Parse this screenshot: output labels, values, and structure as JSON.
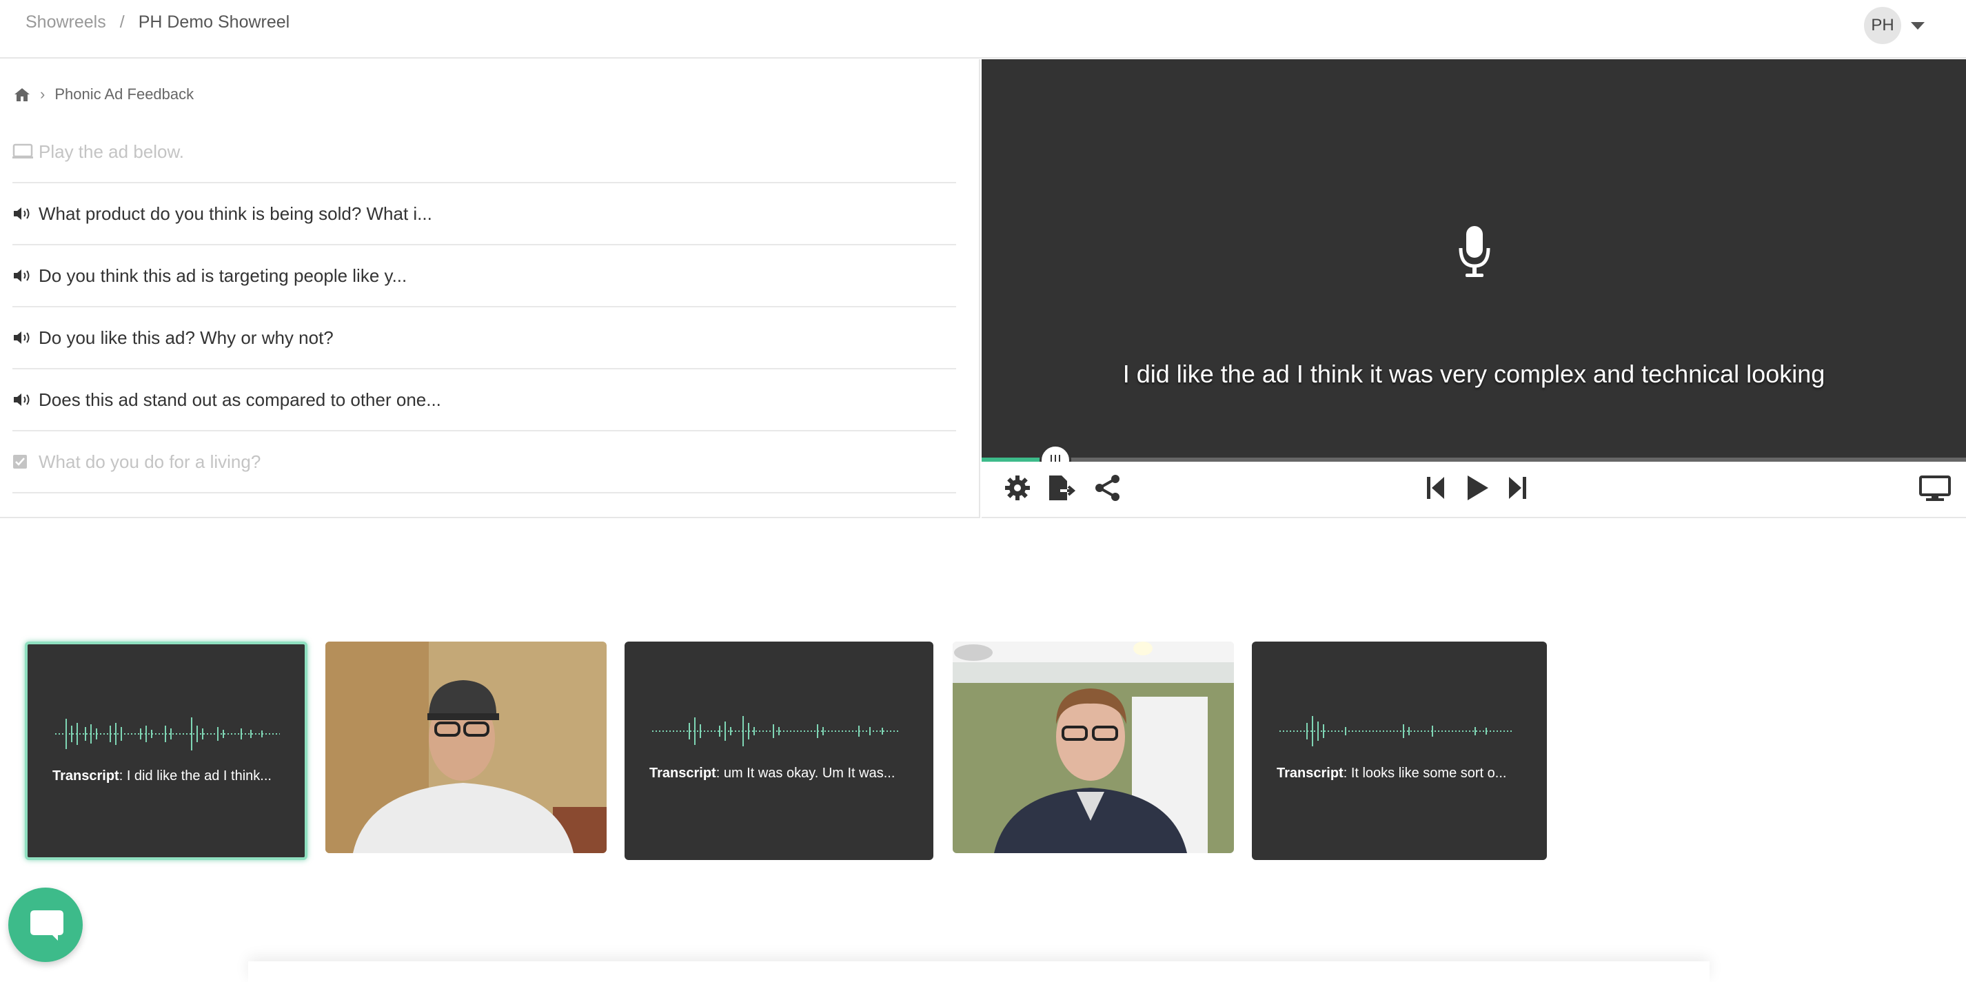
{
  "header": {
    "breadcrumb_root": "Showreels",
    "breadcrumb_separator": "/",
    "breadcrumb_current": "PH Demo Showreel",
    "user_initials": "PH"
  },
  "survey": {
    "breadcrumb_label": "Phonic Ad Feedback",
    "questions": [
      {
        "label": "Play the ad below.",
        "icon": "display-icon",
        "enabled": false
      },
      {
        "label": "What product do you think is being sold? What i...",
        "icon": "speaker-icon",
        "enabled": true
      },
      {
        "label": "Do you think this ad is targeting people like y...",
        "icon": "speaker-icon",
        "enabled": true
      },
      {
        "label": "Do you like this ad? Why or why not?",
        "icon": "speaker-icon",
        "enabled": true
      },
      {
        "label": "Does this ad stand out as compared to other one...",
        "icon": "speaker-icon",
        "enabled": true
      },
      {
        "label": "What do you do for a living?",
        "icon": "checkbox-icon",
        "enabled": false
      }
    ]
  },
  "player": {
    "subtitle": "I did like the ad I think it was very complex and technical looking",
    "progress": 0.075,
    "accent_color": "#3dbb8a"
  },
  "responses": [
    {
      "type": "audio",
      "label": "Transcript",
      "text": ": I did like the ad I think...",
      "active": true
    },
    {
      "type": "video",
      "description": "man in cap"
    },
    {
      "type": "audio",
      "label": "Transcript",
      "text": ": um It was okay. Um It was...",
      "active": false
    },
    {
      "type": "video",
      "description": "man indoors"
    },
    {
      "type": "audio",
      "label": "Transcript",
      "text": ": It looks like some sort o...",
      "active": false
    }
  ]
}
